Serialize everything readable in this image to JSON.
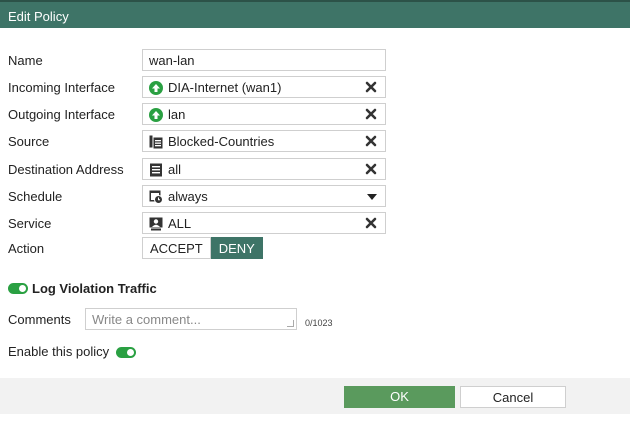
{
  "dialog": {
    "title": "Edit Policy"
  },
  "form": {
    "name_label": "Name",
    "name_value": "wan-lan",
    "incoming_label": "Incoming Interface",
    "incoming_value": "DIA-Internet (wan1)",
    "outgoing_label": "Outgoing Interface",
    "outgoing_value": "lan",
    "source_label": "Source",
    "source_value": "Blocked-Countries",
    "destination_label": "Destination Address",
    "destination_value": "all",
    "schedule_label": "Schedule",
    "schedule_value": "always",
    "service_label": "Service",
    "service_value": "ALL",
    "action_label": "Action",
    "action_accept": "ACCEPT",
    "action_deny": "DENY",
    "action_selected": "DENY"
  },
  "log_violation": {
    "label": "Log Violation Traffic",
    "enabled": true
  },
  "comments": {
    "label": "Comments",
    "placeholder": "Write a comment...",
    "counter": "0/1023"
  },
  "enable_policy": {
    "label": "Enable this policy",
    "enabled": true
  },
  "buttons": {
    "ok": "OK",
    "cancel": "Cancel"
  },
  "icons": {
    "incoming": "interface-up-icon",
    "outgoing": "interface-up-icon",
    "source": "address-group-icon",
    "destination": "address-icon",
    "schedule": "schedule-icon",
    "service": "service-icon",
    "remove": "remove-x-icon",
    "dropdown": "chevron-down-icon"
  },
  "colors": {
    "titlebar": "#3e7467",
    "deny_active": "#3e7467",
    "toggle_on": "#2aa042",
    "ok_button": "#5a9a5d",
    "interface_up": "#2aa042"
  }
}
